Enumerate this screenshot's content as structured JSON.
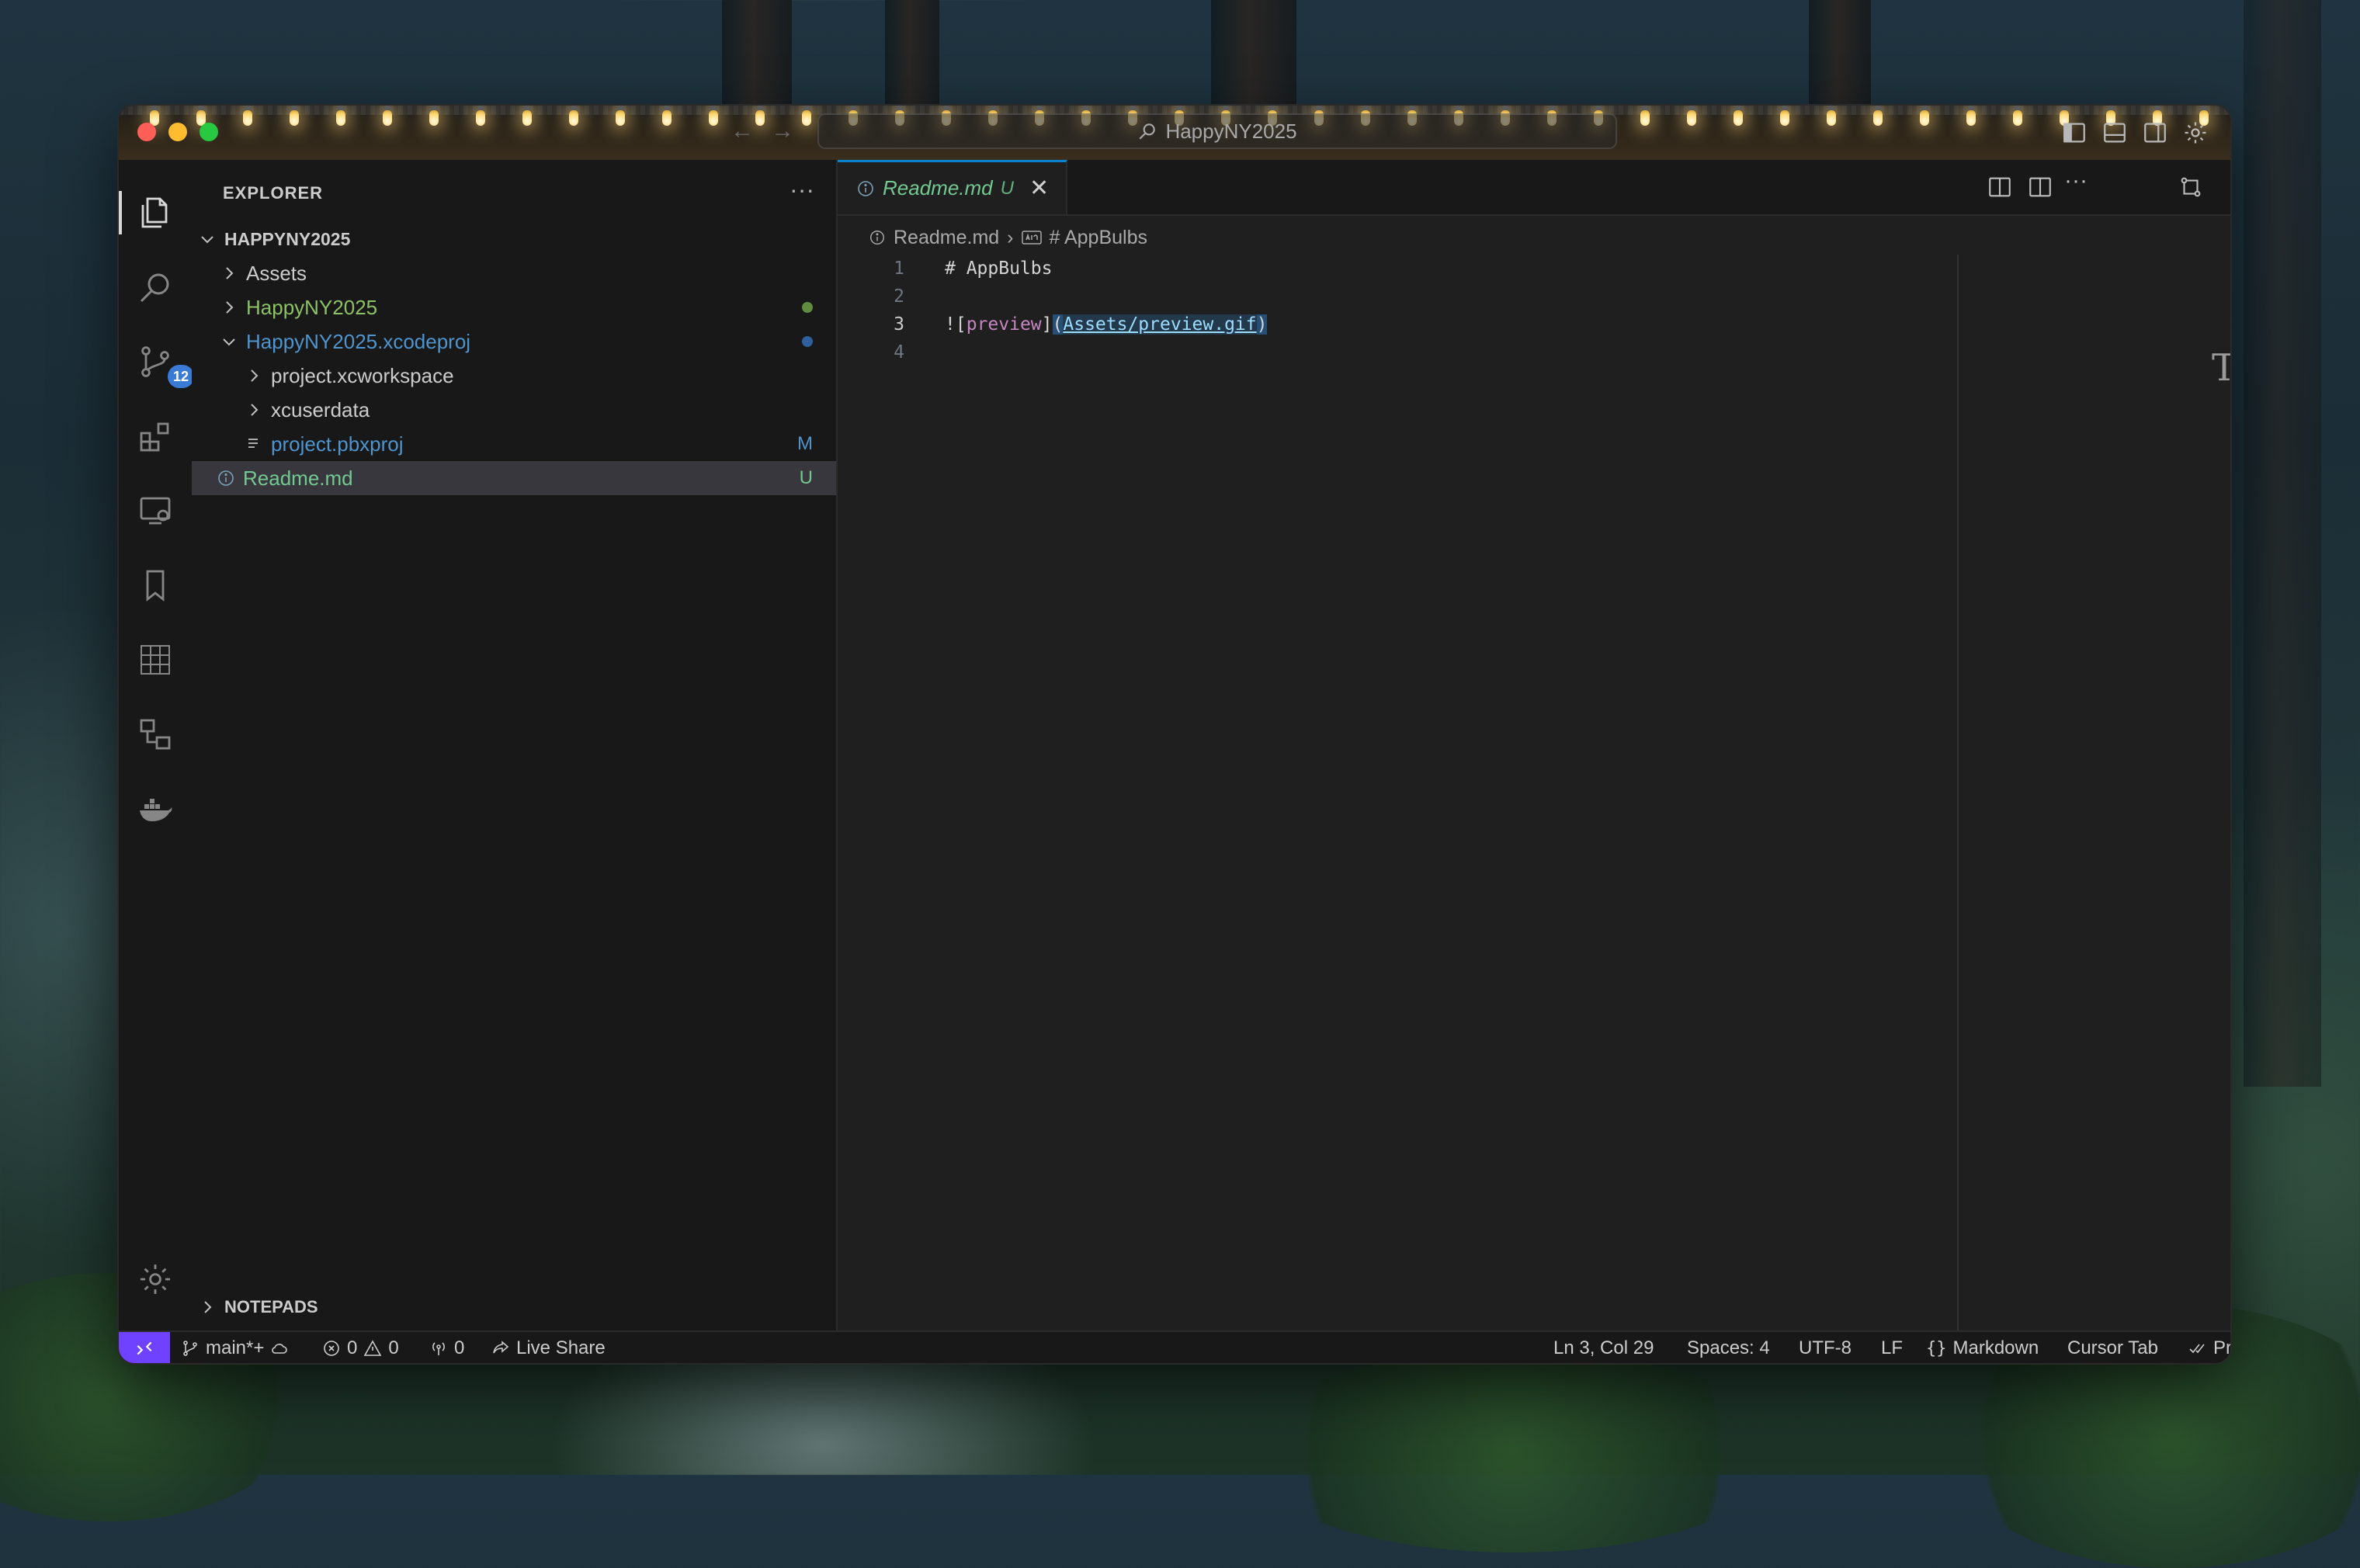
{
  "window": {
    "title": "HappyNY2025",
    "colors": {
      "accent": "#0a84d0",
      "git_added": "#73c991",
      "git_modified": "#4e94ce",
      "folder_green": "#8cc265",
      "remote_purple": "#6f42ff"
    }
  },
  "activity_bar": {
    "items": [
      "explorer-icon",
      "search-icon",
      "source-control-icon",
      "extensions-icon",
      "remote-explorer-icon",
      "bookmarks-icon",
      "sudoku-icon",
      "connections-icon",
      "docker-icon",
      "settings-gear-icon"
    ],
    "source_control_badge": "12"
  },
  "sidebar": {
    "title": "EXPLORER",
    "root": "HAPPYNY2025",
    "items": [
      {
        "label": "Assets"
      },
      {
        "label": "HappyNY2025"
      },
      {
        "label": "HappyNY2025.xcodeproj"
      },
      {
        "label": "project.xcworkspace"
      },
      {
        "label": "xcuserdata"
      },
      {
        "label": "project.pbxproj",
        "status": "M"
      },
      {
        "label": "Readme.md",
        "status": "U"
      }
    ],
    "notepads": "NOTEPADS"
  },
  "editor": {
    "tab": {
      "label": "Readme.md",
      "status": "U"
    },
    "breadcrumb": {
      "file": "Readme.md",
      "symbol": "# AppBulbs"
    },
    "lines": [
      {
        "num": "1",
        "text": "# AppBulbs"
      },
      {
        "num": "2",
        "text": ""
      },
      {
        "num": "3",
        "bang": "!",
        "lb": "[",
        "alt": "preview",
        "rb": "]",
        "lp": "(",
        "url": "Assets/preview.gif",
        "rp": ")"
      },
      {
        "num": "4",
        "text": ""
      }
    ],
    "minimap_glyph": "T"
  },
  "status_bar": {
    "branch": "main*+",
    "errors": "0",
    "warnings": "0",
    "ports": "0",
    "live_share": "Live Share",
    "position": "Ln 3, Col 29",
    "spaces": "Spaces: 4",
    "encoding": "UTF-8",
    "eol": "LF",
    "language": "Markdown",
    "cursor_tab": "Cursor Tab",
    "prettier": "Prettier"
  }
}
